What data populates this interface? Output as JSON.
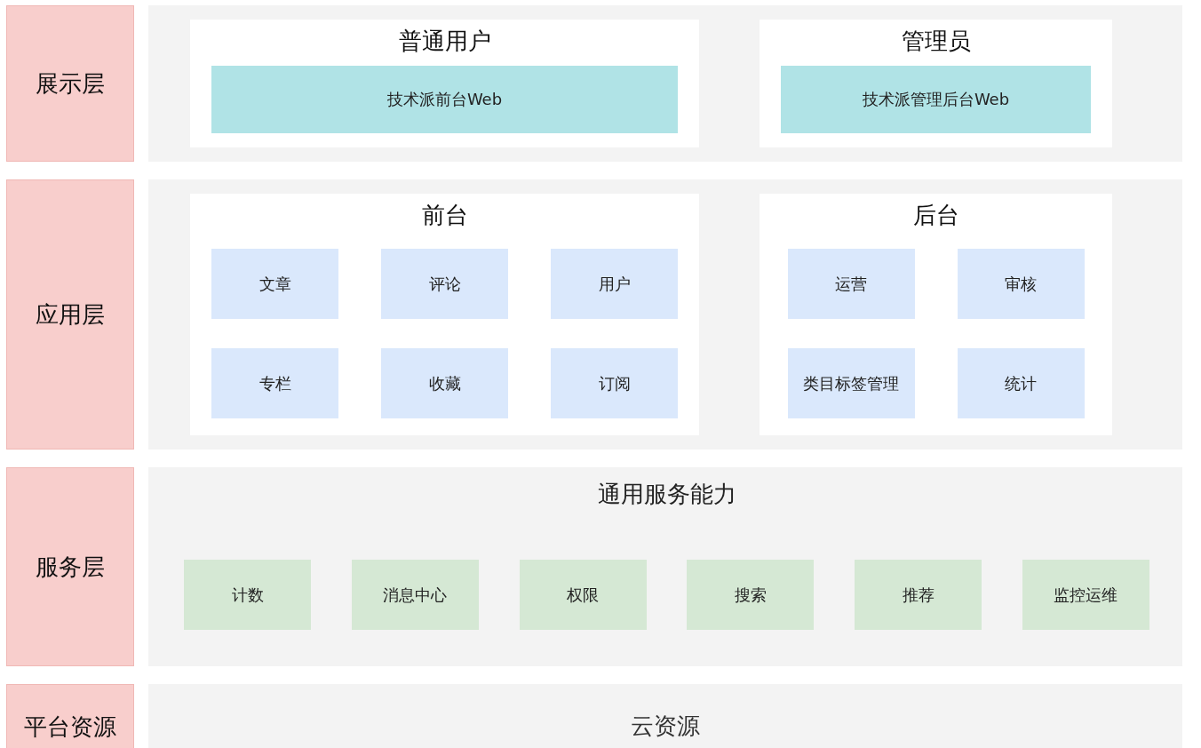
{
  "layers": [
    {
      "kind": "apps",
      "label": "展示层",
      "groups": [
        {
          "title": "普通用户",
          "kind": "bar",
          "items": [
            "技术派前台Web"
          ]
        },
        {
          "title": "管理员",
          "kind": "bar",
          "items": [
            "技术派管理后台Web"
          ]
        }
      ]
    },
    {
      "kind": "apps",
      "label": "应用层",
      "groups": [
        {
          "title": "前台",
          "kind": "grid",
          "items": [
            "文章",
            "评论",
            "用户",
            "专栏",
            "收藏",
            "订阅"
          ]
        },
        {
          "title": "后台",
          "kind": "grid",
          "items": [
            "运营",
            "审核",
            "类目标签管理",
            "统计"
          ]
        }
      ]
    },
    {
      "kind": "services",
      "label": "服务层",
      "title": "通用服务能力",
      "items": [
        "计数",
        "消息中心",
        "权限",
        "搜索",
        "推荐",
        "监控运维"
      ]
    },
    {
      "kind": "resources",
      "label": "平台资源",
      "title": "云资源"
    }
  ]
}
